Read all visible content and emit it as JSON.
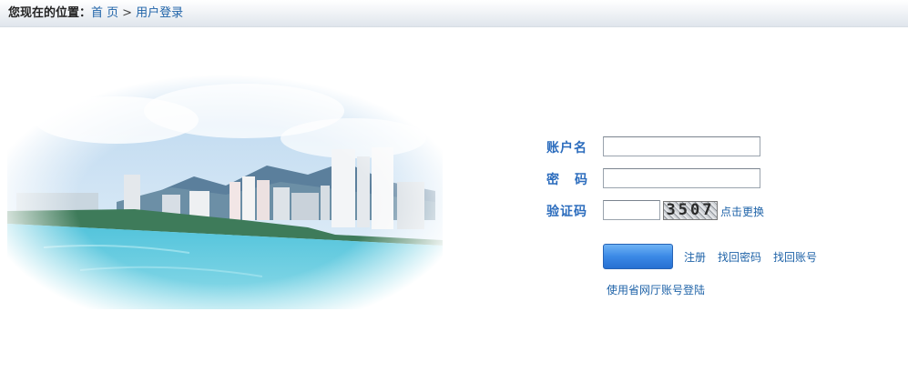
{
  "breadcrumb": {
    "prefix": "您现在的位置：",
    "home": "首 页",
    "separator": ">",
    "current": "用户登录"
  },
  "form": {
    "account_label": "账户名",
    "account_value": "",
    "password_label": "密码",
    "password_value": "",
    "captcha_label": "验证码",
    "captcha_value": "",
    "captcha_text": "3507",
    "captcha_refresh": "点击更换",
    "login_button": "",
    "register_link": "注册",
    "recover_password_link": "找回密码",
    "recover_account_link": "找回账号",
    "province_login_link": "使用省网厅账号登陆"
  },
  "colors": {
    "label": "#2b6cbd",
    "link": "#1f63a8",
    "button": "#3b89e6",
    "sea": "#3bb7d6"
  }
}
